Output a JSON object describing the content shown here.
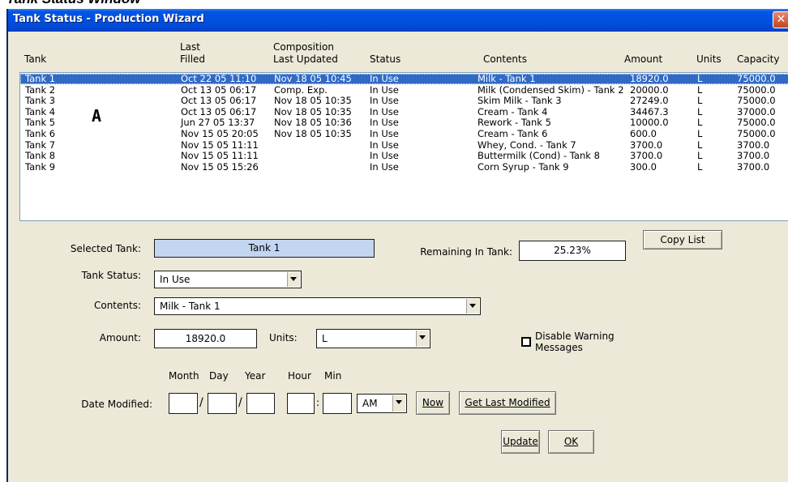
{
  "doc_heading": "Tank Status Window",
  "window": {
    "title": "Tank Status - Production Wizard",
    "close_glyph": "✕"
  },
  "list": {
    "headers": {
      "tank": "Tank",
      "last_filled_1": "Last",
      "last_filled_2": "Filled",
      "composition_1": "Composition",
      "composition_2": "Last Updated",
      "status": "Status",
      "contents": "Contents",
      "amount": "Amount",
      "units": "Units",
      "capacity": "Capacity"
    },
    "rows": [
      {
        "tank": "Tank 1",
        "filled": "Oct 22 05  11:10",
        "comp": "Nov 18 05  10:45",
        "status": "In Use",
        "contents": "Milk - Tank 1",
        "amount": "18920.0",
        "units": "L",
        "capacity": "75000.0"
      },
      {
        "tank": "Tank 2",
        "filled": "Oct 13 05  06:17",
        "comp": "Comp. Exp.",
        "status": "In Use",
        "contents": "Milk (Condensed Skim) - Tank 2",
        "amount": "20000.0",
        "units": "L",
        "capacity": "75000.0"
      },
      {
        "tank": "Tank 3",
        "filled": "Oct 13 05  06:17",
        "comp": "Nov 18 05  10:35",
        "status": "In Use",
        "contents": "Skim Milk - Tank 3",
        "amount": "27249.0",
        "units": "L",
        "capacity": "75000.0"
      },
      {
        "tank": "Tank 4",
        "filled": "Oct 13 05  06:17",
        "comp": "Nov 18 05  10:35",
        "status": "In Use",
        "contents": "Cream - Tank 4",
        "amount": "34467.3",
        "units": "L",
        "capacity": "37000.0"
      },
      {
        "tank": "Tank 5",
        "filled": "Jun 27 05  13:37",
        "comp": "Nov 18 05  10:36",
        "status": "In Use",
        "contents": "Rework - Tank 5",
        "amount": "10000.0",
        "units": "L",
        "capacity": "75000.0"
      },
      {
        "tank": "Tank 6",
        "filled": "Nov 15 05  20:05",
        "comp": "Nov 18 05  10:35",
        "status": "In Use",
        "contents": "Cream - Tank 6",
        "amount": "600.0",
        "units": "L",
        "capacity": "75000.0"
      },
      {
        "tank": "Tank 7",
        "filled": "Nov 15 05  11:11",
        "comp": "",
        "status": "In Use",
        "contents": "Whey, Cond. - Tank 7",
        "amount": "3700.0",
        "units": "L",
        "capacity": "3700.0"
      },
      {
        "tank": "Tank 8",
        "filled": "Nov 15 05  11:11",
        "comp": "",
        "status": "In Use",
        "contents": "Buttermilk (Cond) - Tank 8",
        "amount": "3700.0",
        "units": "L",
        "capacity": "3700.0"
      },
      {
        "tank": "Tank 9",
        "filled": "Nov 15 05  15:26",
        "comp": "",
        "status": "In Use",
        "contents": "Corn Syrup - Tank 9",
        "amount": "300.0",
        "units": "L",
        "capacity": "3700.0"
      }
    ],
    "overlay_marker": "A"
  },
  "form": {
    "selected_tank_label": "Selected Tank:",
    "selected_tank_value": "Tank 1",
    "remaining_label": "Remaining In Tank:",
    "remaining_value": "25.23%",
    "copy_list_label": "Copy List",
    "tank_status_label": "Tank Status:",
    "tank_status_value": "In Use",
    "contents_label": "Contents:",
    "contents_value": "Milk - Tank 1",
    "amount_label": "Amount:",
    "amount_value": "18920.0",
    "units_label": "Units:",
    "units_value": "L",
    "disable_warning_line1": "Disable Warning",
    "disable_warning_line2": "Messages",
    "date_headers": {
      "month": "Month",
      "day": "Day",
      "year": "Year",
      "hour": "Hour",
      "min": "Min"
    },
    "date_modified_label": "Date Modified:",
    "slash": "/",
    "colon": ":",
    "ampm_value": "AM",
    "now_label": "Now",
    "get_last_modified_label": "Get Last Modified",
    "update_label": "Update",
    "ok_label": "OK"
  },
  "colors": {
    "selection": "#316ac5",
    "titlebar": "#0055e5",
    "selected_tank_field": "#c3d5f0"
  }
}
